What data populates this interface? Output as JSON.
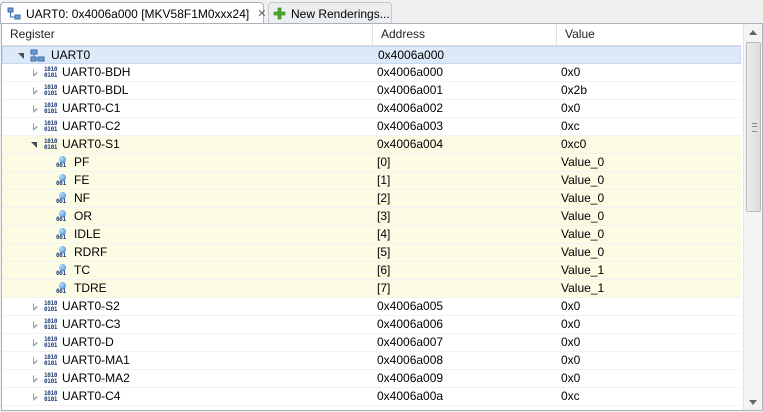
{
  "tabs": {
    "active_label": "UART0: 0x4006a000 [MKV58F1M0xxx24]",
    "close_glyph": "✕",
    "new_label": "New Renderings..."
  },
  "columns": {
    "register": "Register",
    "address": "Address",
    "value": "Value"
  },
  "rows": [
    {
      "name": "UART0",
      "address": "0x4006a000",
      "value": "",
      "kind": "peripheral",
      "level": 0,
      "twisty": "open",
      "state": "selected"
    },
    {
      "name": "UART0-BDH",
      "address": "0x4006a000",
      "value": "0x0",
      "kind": "register",
      "level": 1,
      "twisty": "closed",
      "state": ""
    },
    {
      "name": "UART0-BDL",
      "address": "0x4006a001",
      "value": "0x2b",
      "kind": "register",
      "level": 1,
      "twisty": "closed",
      "state": ""
    },
    {
      "name": "UART0-C1",
      "address": "0x4006a002",
      "value": "0x0",
      "kind": "register",
      "level": 1,
      "twisty": "closed",
      "state": ""
    },
    {
      "name": "UART0-C2",
      "address": "0x4006a003",
      "value": "0xc",
      "kind": "register",
      "level": 1,
      "twisty": "closed",
      "state": ""
    },
    {
      "name": "UART0-S1",
      "address": "0x4006a004",
      "value": "0xc0",
      "kind": "register",
      "level": 1,
      "twisty": "open",
      "state": "highlight"
    },
    {
      "name": "PF",
      "address": "[0]",
      "value": "Value_0",
      "kind": "field",
      "level": 2,
      "twisty": "none",
      "state": "highlight"
    },
    {
      "name": "FE",
      "address": "[1]",
      "value": "Value_0",
      "kind": "field",
      "level": 2,
      "twisty": "none",
      "state": "highlight"
    },
    {
      "name": "NF",
      "address": "[2]",
      "value": "Value_0",
      "kind": "field",
      "level": 2,
      "twisty": "none",
      "state": "highlight"
    },
    {
      "name": "OR",
      "address": "[3]",
      "value": "Value_0",
      "kind": "field",
      "level": 2,
      "twisty": "none",
      "state": "highlight"
    },
    {
      "name": "IDLE",
      "address": "[4]",
      "value": "Value_0",
      "kind": "field",
      "level": 2,
      "twisty": "none",
      "state": "highlight"
    },
    {
      "name": "RDRF",
      "address": "[5]",
      "value": "Value_0",
      "kind": "field",
      "level": 2,
      "twisty": "none",
      "state": "highlight"
    },
    {
      "name": "TC",
      "address": "[6]",
      "value": "Value_1",
      "kind": "field",
      "level": 2,
      "twisty": "none",
      "state": "highlight"
    },
    {
      "name": "TDRE",
      "address": "[7]",
      "value": "Value_1",
      "kind": "field",
      "level": 2,
      "twisty": "none",
      "state": "highlight"
    },
    {
      "name": "UART0-S2",
      "address": "0x4006a005",
      "value": "0x0",
      "kind": "register",
      "level": 1,
      "twisty": "closed",
      "state": ""
    },
    {
      "name": "UART0-C3",
      "address": "0x4006a006",
      "value": "0x0",
      "kind": "register",
      "level": 1,
      "twisty": "closed",
      "state": ""
    },
    {
      "name": "UART0-D",
      "address": "0x4006a007",
      "value": "0x0",
      "kind": "register",
      "level": 1,
      "twisty": "closed",
      "state": ""
    },
    {
      "name": "UART0-MA1",
      "address": "0x4006a008",
      "value": "0x0",
      "kind": "register",
      "level": 1,
      "twisty": "closed",
      "state": ""
    },
    {
      "name": "UART0-MA2",
      "address": "0x4006a009",
      "value": "0x0",
      "kind": "register",
      "level": 1,
      "twisty": "closed",
      "state": ""
    },
    {
      "name": "UART0-C4",
      "address": "0x4006a00a",
      "value": "0xc",
      "kind": "register",
      "level": 1,
      "twisty": "closed",
      "state": ""
    }
  ],
  "icons": {
    "register_bits_top": "1010",
    "register_bits_bottom": "0101",
    "field_bits": "001"
  },
  "colors": {
    "selected_row": "#dce9f8",
    "highlight_row": "#fcfbe3",
    "border": "#a9b2bd"
  }
}
